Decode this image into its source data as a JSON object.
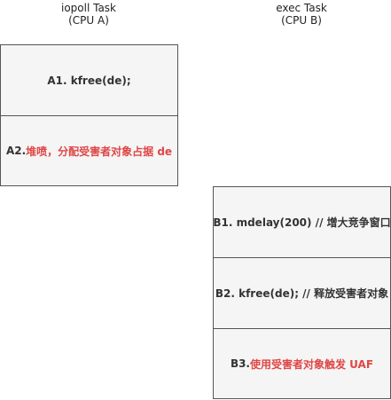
{
  "columns": [
    {
      "title_line1": "iopoll Task",
      "title_line2": "(CPU A)",
      "steps": [
        {
          "id": "A1",
          "prefix": "A1. kfree(de);",
          "highlight": ""
        },
        {
          "id": "A2",
          "prefix": "A2. ",
          "highlight": "堆喷，分配受害者对象占据 de"
        }
      ]
    },
    {
      "title_line1": "exec Task",
      "title_line2": "(CPU B)",
      "steps": [
        {
          "id": "B1",
          "prefix": "B1. mdelay(200) // 增大竞争窗口",
          "highlight": ""
        },
        {
          "id": "B2",
          "prefix": "B2. kfree(de); // 释放受害者对象",
          "highlight": ""
        },
        {
          "id": "B3",
          "prefix": "B3. ",
          "highlight": "使用受害者对象触发 UAF"
        }
      ]
    }
  ],
  "colors": {
    "box_fill": "#f5f5f5",
    "box_border": "#555555",
    "text": "#333333",
    "highlight": "#e04646"
  }
}
